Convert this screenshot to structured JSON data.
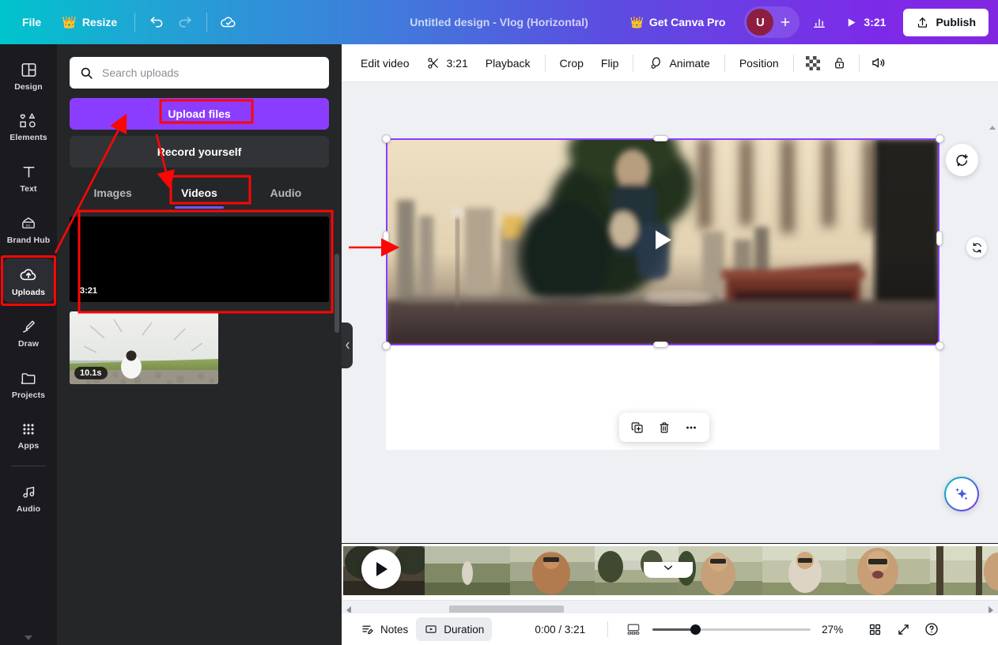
{
  "header": {
    "file_label": "File",
    "resize_label": "Resize",
    "crown_icon": "crown-icon",
    "undo_icon": "undo-icon",
    "redo_icon": "redo-icon",
    "cloud_saved_icon": "cloud-check-icon",
    "design_title": "Untitled design - Vlog (Horizontal)",
    "get_pro_label": "Get Canva Pro",
    "avatar_initial": "U",
    "add_collaborator_icon": "plus-icon",
    "insights_icon": "bar-chart-icon",
    "play_icon": "play-icon",
    "duration": "3:21",
    "publish_label": "Publish",
    "publish_icon": "upload-icon",
    "gradient_start": "#00c4cc",
    "gradient_end": "#8127e0"
  },
  "rail": {
    "items": [
      {
        "label": "Design",
        "icon": "layout-icon",
        "active": false
      },
      {
        "label": "Elements",
        "icon": "shapes-icon",
        "active": false
      },
      {
        "label": "Text",
        "icon": "text-icon",
        "active": false
      },
      {
        "label": "Brand Hub",
        "icon": "brand-hub-icon",
        "active": false
      },
      {
        "label": "Uploads",
        "icon": "cloud-upload-icon",
        "active": true
      },
      {
        "label": "Draw",
        "icon": "pen-icon",
        "active": false
      },
      {
        "label": "Projects",
        "icon": "folder-icon",
        "active": false
      },
      {
        "label": "Apps",
        "icon": "grid-dots-icon",
        "active": false
      },
      {
        "label": "Audio",
        "icon": "music-note-icon",
        "active": false
      }
    ]
  },
  "panel": {
    "search": {
      "placeholder": "Search uploads",
      "value": "",
      "icon": "search-icon"
    },
    "upload_files_label": "Upload files",
    "record_yourself_label": "Record yourself",
    "tabs": [
      {
        "label": "Images",
        "active": false
      },
      {
        "label": "Videos",
        "active": true
      },
      {
        "label": "Audio",
        "active": false
      }
    ],
    "thumbnails": [
      {
        "name": "black-video-thumbnail",
        "duration": "3:21"
      },
      {
        "name": "beach-video-thumbnail",
        "duration": "10.1s"
      }
    ],
    "collapse_icon": "chevron-left-icon"
  },
  "toolbar": {
    "edit_video_label": "Edit video",
    "scissors_icon": "scissors-icon",
    "trim_duration": "3:21",
    "playback_label": "Playback",
    "crop_label": "Crop",
    "flip_label": "Flip",
    "animate_label": "Animate",
    "animate_icon": "animate-icon",
    "position_label": "Position",
    "transparency_icon": "transparency-icon",
    "lock_icon": "lock-icon",
    "volume_icon": "volume-icon"
  },
  "canvas": {
    "play_button_icon": "play-triangle-icon",
    "selection_color": "#8b3dff",
    "float_toolbar": [
      {
        "name": "duplicate-button",
        "icon": "duplicate-icon"
      },
      {
        "name": "delete-button",
        "icon": "trash-icon"
      },
      {
        "name": "more-options-button",
        "icon": "ellipsis-icon"
      }
    ],
    "comment_icon": "add-comment-icon",
    "rotate_icon": "rotate-icon",
    "magic_icon": "magic-sparkle-icon",
    "page_collapse_icon": "chevron-down-icon"
  },
  "timeline": {
    "play_icon": "play-triangle-icon",
    "clip_count": 8
  },
  "statusbar": {
    "notes_label": "Notes",
    "notes_icon": "notes-icon",
    "duration_label": "Duration",
    "duration_icon": "duration-icon",
    "time_display": "0:00 / 3:21",
    "timeline_toggle_icon": "timeline-view-icon",
    "zoom_value": "27%",
    "grid_view_icon": "grid-view-icon",
    "fullscreen_icon": "expand-icon",
    "help_icon": "help-icon"
  },
  "annotations": {
    "color": "#fd0606",
    "highlights": [
      "uploads-rail-item",
      "upload-files-button",
      "videos-tab",
      "black-video-thumbnail-row"
    ],
    "arrows": [
      "arrow-to-uploads",
      "arrow-to-videos-tab",
      "arrow-to-canvas-video"
    ]
  }
}
